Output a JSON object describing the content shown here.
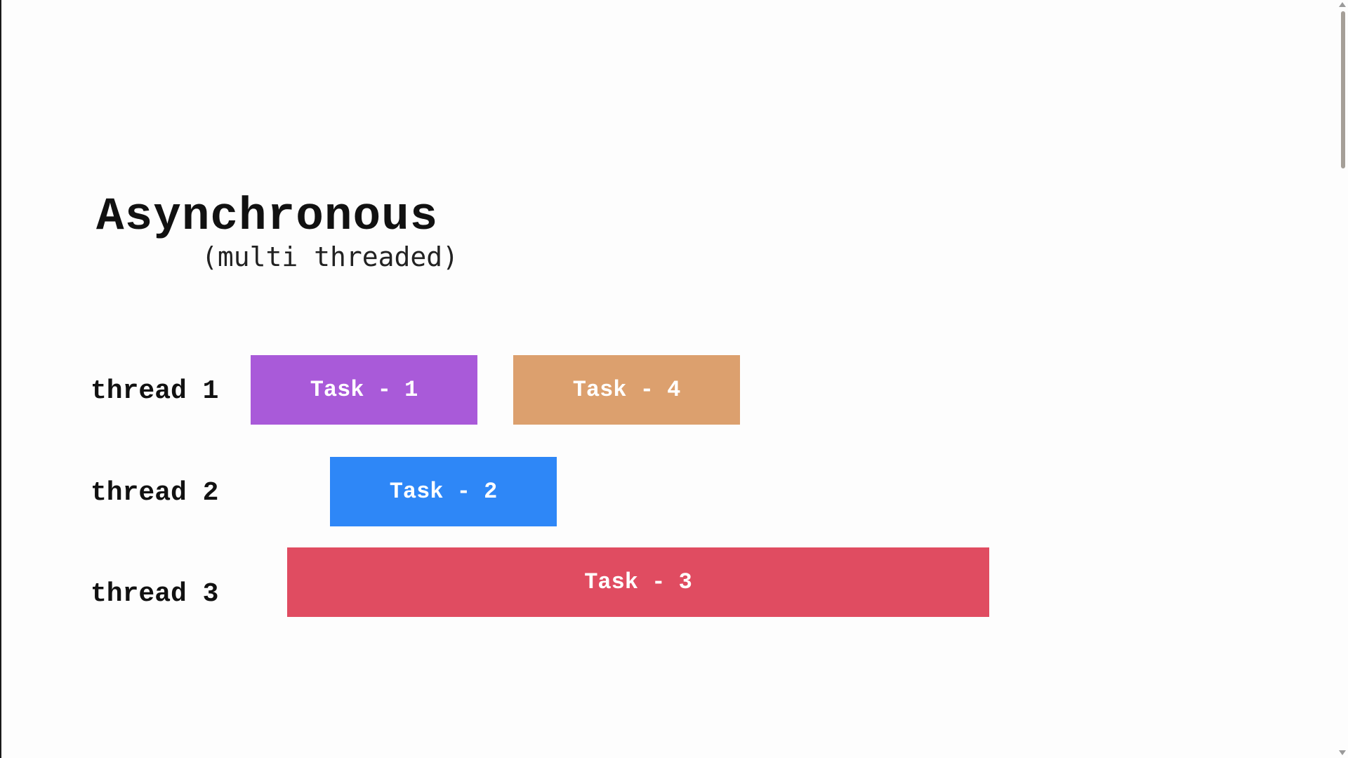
{
  "title": "Asynchronous",
  "subtitle": "(multi threaded)",
  "threads": [
    {
      "label": "thread 1"
    },
    {
      "label": "thread 2"
    },
    {
      "label": "thread 3"
    }
  ],
  "tasks": [
    {
      "label": "Task - 1",
      "thread": "thread 1",
      "color": "#a95ad9"
    },
    {
      "label": "Task - 4",
      "thread": "thread 1",
      "color": "#dca06e"
    },
    {
      "label": "Task - 2",
      "thread": "thread 2",
      "color": "#2e87f7"
    },
    {
      "label": "Task - 3",
      "thread": "thread 3",
      "color": "#e04c61"
    }
  ]
}
